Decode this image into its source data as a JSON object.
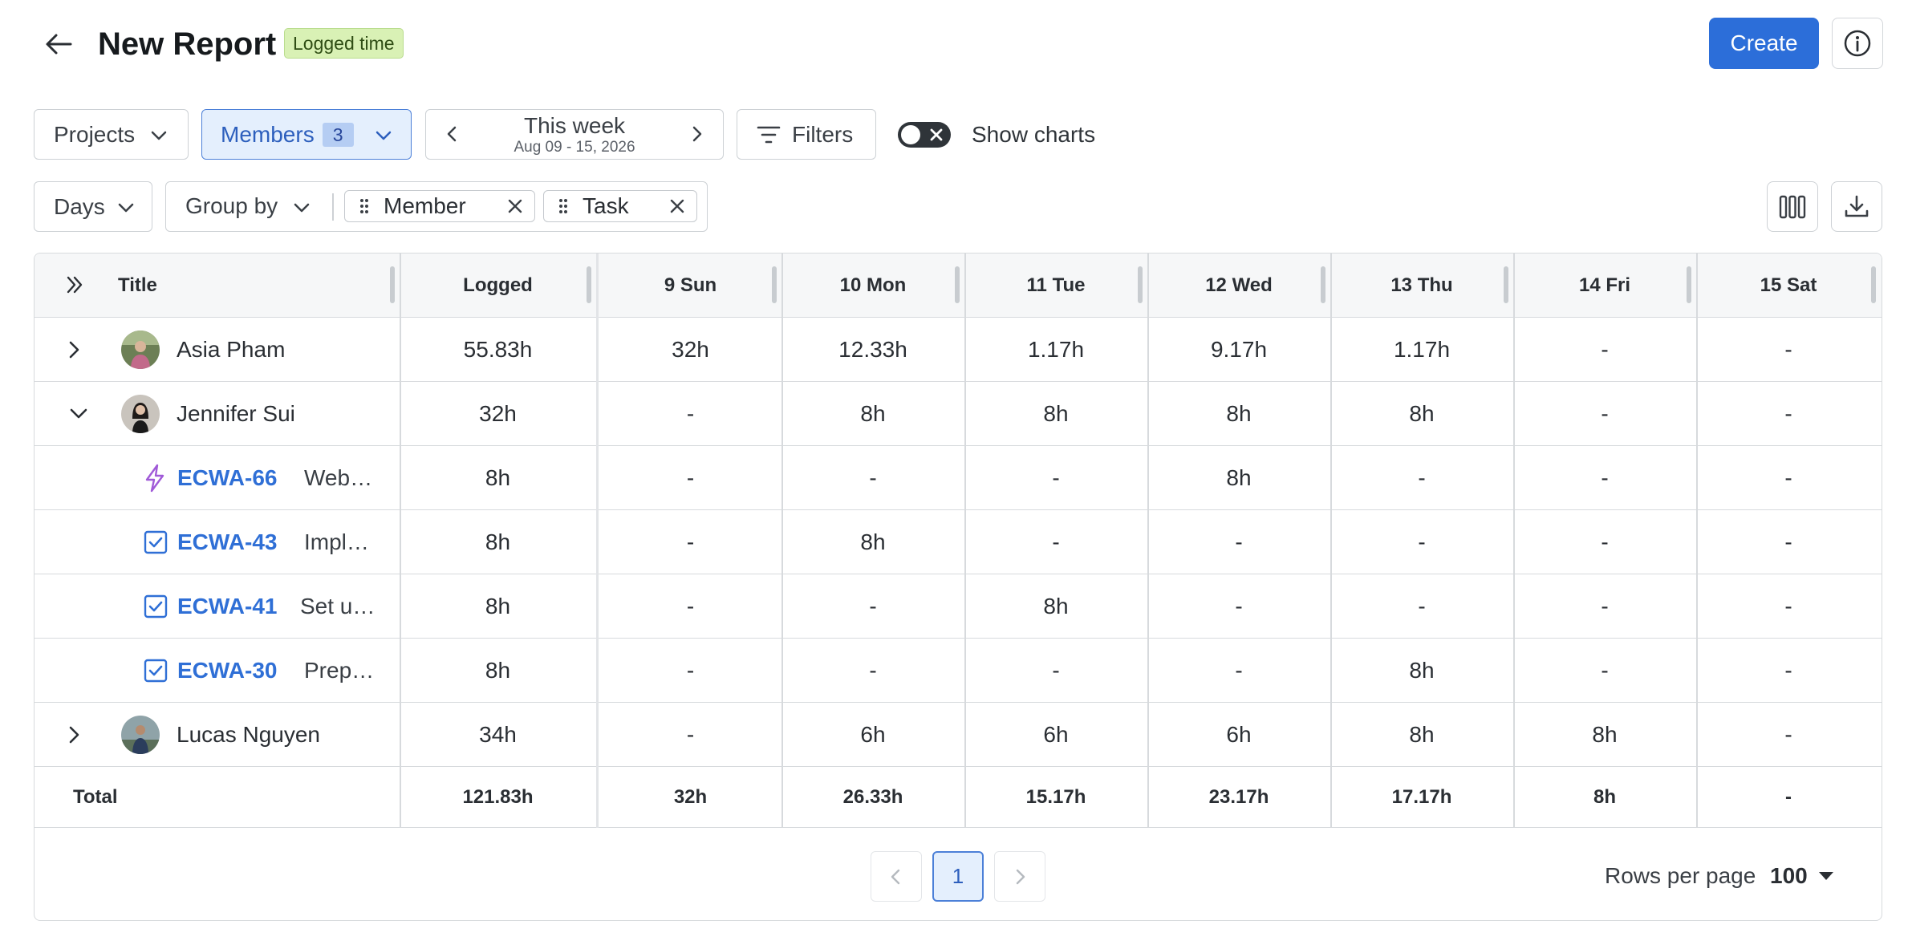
{
  "header": {
    "title": "New Report",
    "badge": "Logged time",
    "create_label": "Create"
  },
  "toolbar": {
    "projects_label": "Projects",
    "members_label": "Members",
    "members_count": "3",
    "week_label": "This week",
    "week_range": "Aug 09 - 15, 2026",
    "filters_label": "Filters",
    "show_charts_label": "Show charts",
    "show_charts_on": false,
    "days_label": "Days",
    "group_by_label": "Group by",
    "group_chips": [
      "Member",
      "Task"
    ]
  },
  "table": {
    "headers": {
      "title": "Title",
      "logged": "Logged",
      "days": [
        "9 Sun",
        "10 Mon",
        "11 Tue",
        "12 Wed",
        "13 Thu",
        "14 Fri",
        "15 Sat"
      ]
    },
    "rows": [
      {
        "type": "member",
        "expanded": false,
        "name": "Asia Pham",
        "logged": "55.83h",
        "days": [
          "32h",
          "12.33h",
          "1.17h",
          "9.17h",
          "1.17h",
          "-",
          "-"
        ]
      },
      {
        "type": "member",
        "expanded": true,
        "name": "Jennifer Sui",
        "logged": "32h",
        "days": [
          "-",
          "8h",
          "8h",
          "8h",
          "8h",
          "-",
          "-"
        ]
      },
      {
        "type": "task",
        "icon": "lightning-icon",
        "key": "ECWA-66",
        "title": "Web…",
        "logged": "8h",
        "days": [
          "-",
          "-",
          "-",
          "8h",
          "-",
          "-",
          "-"
        ]
      },
      {
        "type": "task",
        "icon": "checkbox-icon",
        "key": "ECWA-43",
        "title": "Impl…",
        "logged": "8h",
        "days": [
          "-",
          "8h",
          "-",
          "-",
          "-",
          "-",
          "-"
        ]
      },
      {
        "type": "task",
        "icon": "checkbox-icon",
        "key": "ECWA-41",
        "title": "Set u…",
        "logged": "8h",
        "days": [
          "-",
          "-",
          "8h",
          "-",
          "-",
          "-",
          "-"
        ]
      },
      {
        "type": "task",
        "icon": "checkbox-icon",
        "key": "ECWA-30",
        "title": "Prep…",
        "logged": "8h",
        "days": [
          "-",
          "-",
          "-",
          "-",
          "8h",
          "-",
          "-"
        ]
      },
      {
        "type": "member",
        "expanded": false,
        "name": "Lucas Nguyen",
        "logged": "34h",
        "days": [
          "-",
          "6h",
          "6h",
          "6h",
          "8h",
          "8h",
          "-"
        ]
      }
    ],
    "total": {
      "label": "Total",
      "logged": "121.83h",
      "days": [
        "32h",
        "26.33h",
        "15.17h",
        "23.17h",
        "17.17h",
        "8h",
        "-"
      ]
    }
  },
  "pagination": {
    "current_page": "1",
    "rows_per_page_label": "Rows per page",
    "rows_per_page_value": "100"
  },
  "colors": {
    "accent": "#2c6ed9",
    "badge_bg": "#d9f1b5",
    "task_key": "#2f6fd6",
    "lightning_icon": "#a05ad8"
  }
}
